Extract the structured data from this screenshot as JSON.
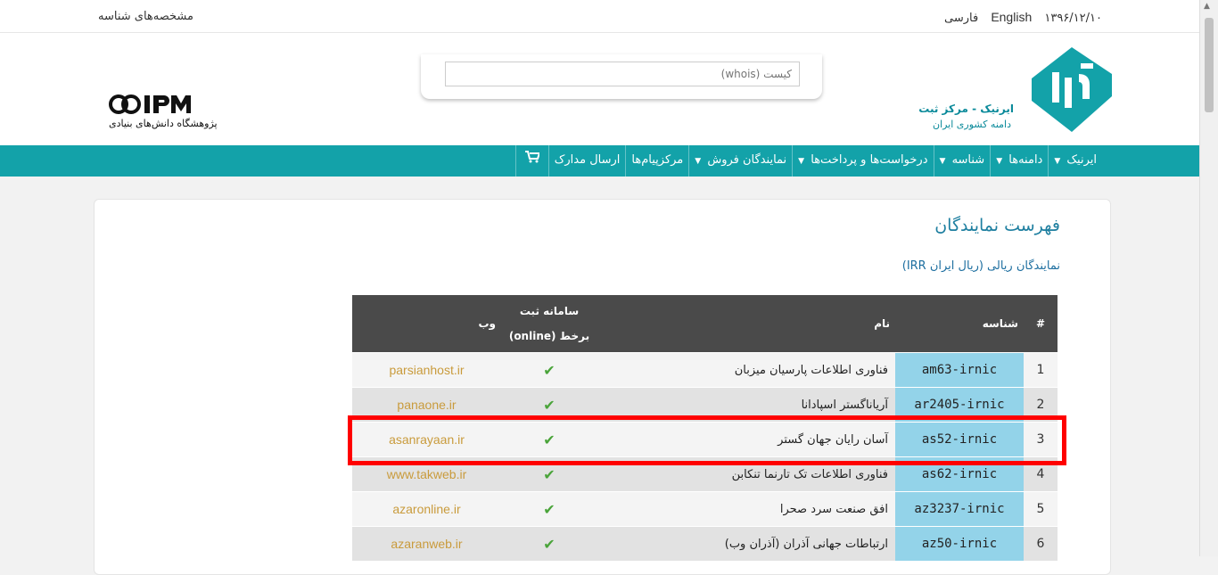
{
  "topbar": {
    "account_link": "مشخصه‌های شناسه",
    "date": "۱۳۹۶/۱۲/۱۰",
    "lang_en": "English",
    "lang_fa": "فارسی"
  },
  "header": {
    "search_placeholder": "کیست (whois)",
    "ipm_logo_text": "IPM",
    "ipm_subtitle": "پژوهشگاه دانش‌های بنیادی",
    "irnic_title": "ایرنیک - مرکز ثبت",
    "irnic_subtitle": "دامنه کشوری ایران"
  },
  "nav": {
    "items": [
      {
        "label": "ایرنیک",
        "dropdown": true
      },
      {
        "label": "دامنه‌ها",
        "dropdown": true
      },
      {
        "label": "شناسه",
        "dropdown": true
      },
      {
        "label": "درخواست‌ها و پرداخت‌ها",
        "dropdown": true
      },
      {
        "label": "نمایندگان فروش",
        "dropdown": true
      },
      {
        "label": "مرکزپیام‌ها",
        "dropdown": false
      },
      {
        "label": "ارسال مدارک",
        "dropdown": false
      }
    ],
    "cart_icon": "shopping-cart-icon"
  },
  "main": {
    "title": "فهرست نمایندگان",
    "subtitle": "نمایندگان ریالی (ریال ایران IRR)",
    "table": {
      "headers": {
        "num": "#",
        "id": "شناسه",
        "name": "نام",
        "online_line1": "سامانه ثبت",
        "online_line2": "برخط (online)",
        "web": "وب"
      },
      "rows": [
        {
          "num": "1",
          "id": "am63-irnic",
          "name": "فناوری اطلاعات پارسیان میزبان",
          "online": "✔",
          "web": "parsianhost.ir"
        },
        {
          "num": "2",
          "id": "ar2405-irnic",
          "name": "آریاناگستر اسپادانا",
          "online": "✔",
          "web": "panaone.ir"
        },
        {
          "num": "3",
          "id": "as52-irnic",
          "name": "آسان رایان جهان گستر",
          "online": "✔",
          "web": "asanrayaan.ir"
        },
        {
          "num": "4",
          "id": "as62-irnic",
          "name": "فناوری اطلاعات تک تارنما تنکابن",
          "online": "✔",
          "web": "www.takweb.ir"
        },
        {
          "num": "5",
          "id": "az3237-irnic",
          "name": "افق صنعت سرد صحرا",
          "online": "✔",
          "web": "azaronline.ir"
        },
        {
          "num": "6",
          "id": "az50-irnic",
          "name": "ارتباطات جهانی آذران (آذران وب)",
          "online": "✔",
          "web": "azaranweb.ir"
        }
      ]
    },
    "highlight_color": "#ff0000"
  },
  "colors": {
    "nav_bg": "#13a2a9",
    "id_cell_bg": "#93d3e9",
    "link": "#c99b3c",
    "check": "#4aa43a"
  }
}
